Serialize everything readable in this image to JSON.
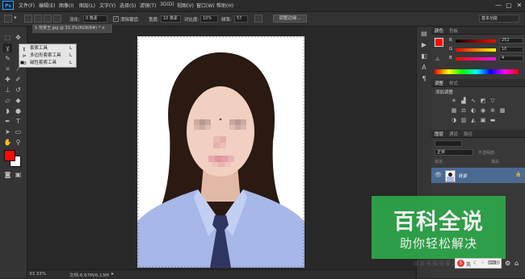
{
  "app": {
    "logo": "Ps"
  },
  "menu": [
    "文件(F)",
    "编辑(E)",
    "图像(I)",
    "图层(L)",
    "文字(Y)",
    "选择(S)",
    "滤镜(T)",
    "3D(D)",
    "视图(V)",
    "窗口(W)",
    "帮助(H)"
  ],
  "window_controls": [
    "—",
    "▢",
    "✕"
  ],
  "options": {
    "feather_label": "羽化:",
    "feather_value": "0 像素",
    "antialias_label": "消除锯齿",
    "width_label": "宽度:",
    "width_value": "10 像素",
    "contrast_label": "对比度:",
    "contrast_value": "10%",
    "frequency_label": "频率:",
    "frequency_value": "57",
    "refine_edge": "调整边缘...",
    "workspace": "基本功能"
  },
  "document": {
    "tab": "1-背景王.jpg @ 33.3%(RGB/8#) * ×"
  },
  "flyout": {
    "items": [
      {
        "label": "套索工具",
        "key": "L",
        "selected": false
      },
      {
        "label": "多边形套索工具",
        "key": "L",
        "selected": false
      },
      {
        "label": "磁性套索工具",
        "key": "L",
        "selected": true
      }
    ]
  },
  "color_panel": {
    "tabs": [
      "颜色",
      "色板"
    ],
    "channels": [
      {
        "label": "R",
        "value": "252",
        "color": "#e03030"
      },
      {
        "label": "G",
        "value": "10",
        "color": "#20c020"
      },
      {
        "label": "B",
        "value": "4",
        "color": "#3040e0"
      }
    ],
    "fg_color": "#fc0a04"
  },
  "adjust_panel": {
    "tabs": [
      "调整",
      "样式"
    ],
    "title": "添加调整"
  },
  "layers_panel": {
    "tabs": [
      "图层",
      "通道",
      "路径"
    ],
    "blend_mode": "正常",
    "opacity_label": "不透明度:",
    "lock_label": "锁定:",
    "fill_label": "填充:",
    "layer_name": "背景"
  },
  "status": {
    "zoom": "33.33%",
    "doc_size": "文档:6.67M/6.13M"
  },
  "watermark": {
    "main": "百科全说",
    "sub": "助你轻松解决",
    "color": "#2ea64a"
  },
  "overlay": {
    "ime_label": "英",
    "faint_text": "拜 背 电 脑 就 要 迷 路 了"
  }
}
